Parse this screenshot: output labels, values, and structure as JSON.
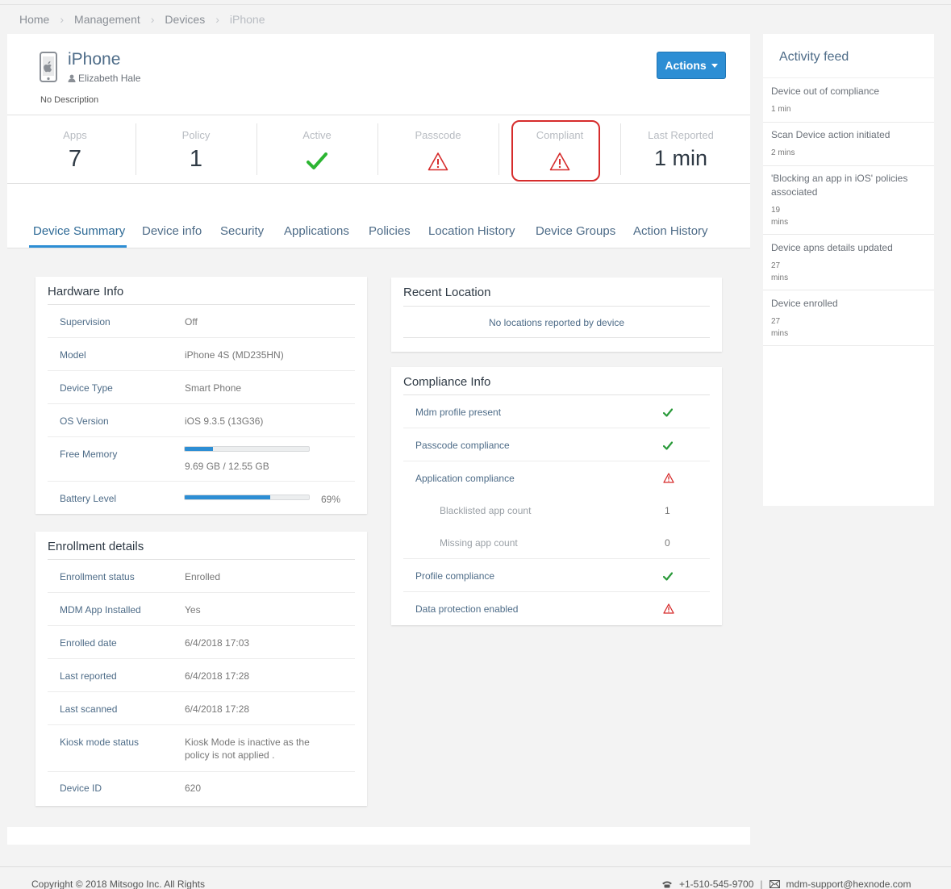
{
  "breadcrumb": [
    {
      "label": "Home"
    },
    {
      "label": "Management"
    },
    {
      "label": "Devices"
    },
    {
      "label": "iPhone"
    }
  ],
  "device": {
    "name": "iPhone",
    "user": "Elizabeth Hale",
    "description": "No Description",
    "actions_label": "Actions"
  },
  "stats": {
    "apps": {
      "label": "Apps",
      "value": "7"
    },
    "policy": {
      "label": "Policy",
      "value": "1"
    },
    "active": {
      "label": "Active",
      "icon": "check-icon"
    },
    "passcode": {
      "label": "Passcode",
      "icon": "warning-icon"
    },
    "compliant": {
      "label": "Compliant",
      "icon": "warning-icon"
    },
    "last_reported": {
      "label": "Last Reported",
      "value": "1 min"
    }
  },
  "tabs": [
    "Device Summary",
    "Device info",
    "Security",
    "Applications",
    "Policies",
    "Location History",
    "Device Groups",
    "Action History"
  ],
  "hardware": {
    "title": "Hardware Info",
    "supervision": {
      "label": "Supervision",
      "value": "Off"
    },
    "model": {
      "label": "Model",
      "value": "iPhone 4S (MD235HN)"
    },
    "device_type": {
      "label": "Device Type",
      "value": "Smart Phone"
    },
    "os_version": {
      "label": "OS Version",
      "value": "iOS 9.3.5 (13G36)"
    },
    "free_memory": {
      "label": "Free Memory",
      "value": "9.69 GB / 12.55 GB",
      "fraction": 0.23
    },
    "battery": {
      "label": "Battery Level",
      "value": "69%",
      "fraction": 0.69
    }
  },
  "enrollment": {
    "title": "Enrollment details",
    "rows": [
      {
        "label": "Enrollment status",
        "value": "Enrolled"
      },
      {
        "label": "MDM App Installed",
        "value": "Yes"
      },
      {
        "label": "Enrolled date",
        "value": "6/4/2018 17:03"
      },
      {
        "label": "Last reported",
        "value": "6/4/2018 17:28"
      },
      {
        "label": "Last scanned",
        "value": "6/4/2018 17:28"
      },
      {
        "label": "Kiosk mode status",
        "value": "Kiosk Mode is inactive as the policy is not applied ."
      },
      {
        "label": "Device ID",
        "value": "620"
      }
    ]
  },
  "location": {
    "title": "Recent Location",
    "empty_text": "No locations reported by device"
  },
  "compliance": {
    "title": "Compliance Info",
    "mdm_profile": {
      "label": "Mdm profile present",
      "status": "check-icon"
    },
    "passcode": {
      "label": "Passcode compliance",
      "status": "check-icon"
    },
    "application": {
      "label": "Application compliance",
      "status": "warning-icon"
    },
    "blacklisted": {
      "label": "Blacklisted app count",
      "value": "1"
    },
    "missing": {
      "label": "Missing app count",
      "value": "0"
    },
    "profile": {
      "label": "Profile compliance",
      "status": "check-icon"
    },
    "data_protection": {
      "label": "Data protection enabled",
      "status": "warning-icon"
    }
  },
  "feed": {
    "title": "Activity feed",
    "items": [
      {
        "text": "Device out of compliance",
        "time": "1 min"
      },
      {
        "text": "Scan Device action initiated",
        "time": "2 mins"
      },
      {
        "text": "'Blocking an app in iOS' policies associated",
        "time": "19\nmins"
      },
      {
        "text": "Device apns details updated",
        "time": "27\nmins"
      },
      {
        "text": "Device enrolled",
        "time": "27\nmins"
      }
    ]
  },
  "footer": {
    "copyright": "Copyright © 2018 Mitsogo Inc. All Rights",
    "phone": "+1-510-545-9700",
    "separator": "|",
    "email": "mdm-support@hexnode.com"
  },
  "colors": {
    "accent": "#2d8ed4",
    "success": "#2a9a3a",
    "warning": "#d62c2c"
  }
}
